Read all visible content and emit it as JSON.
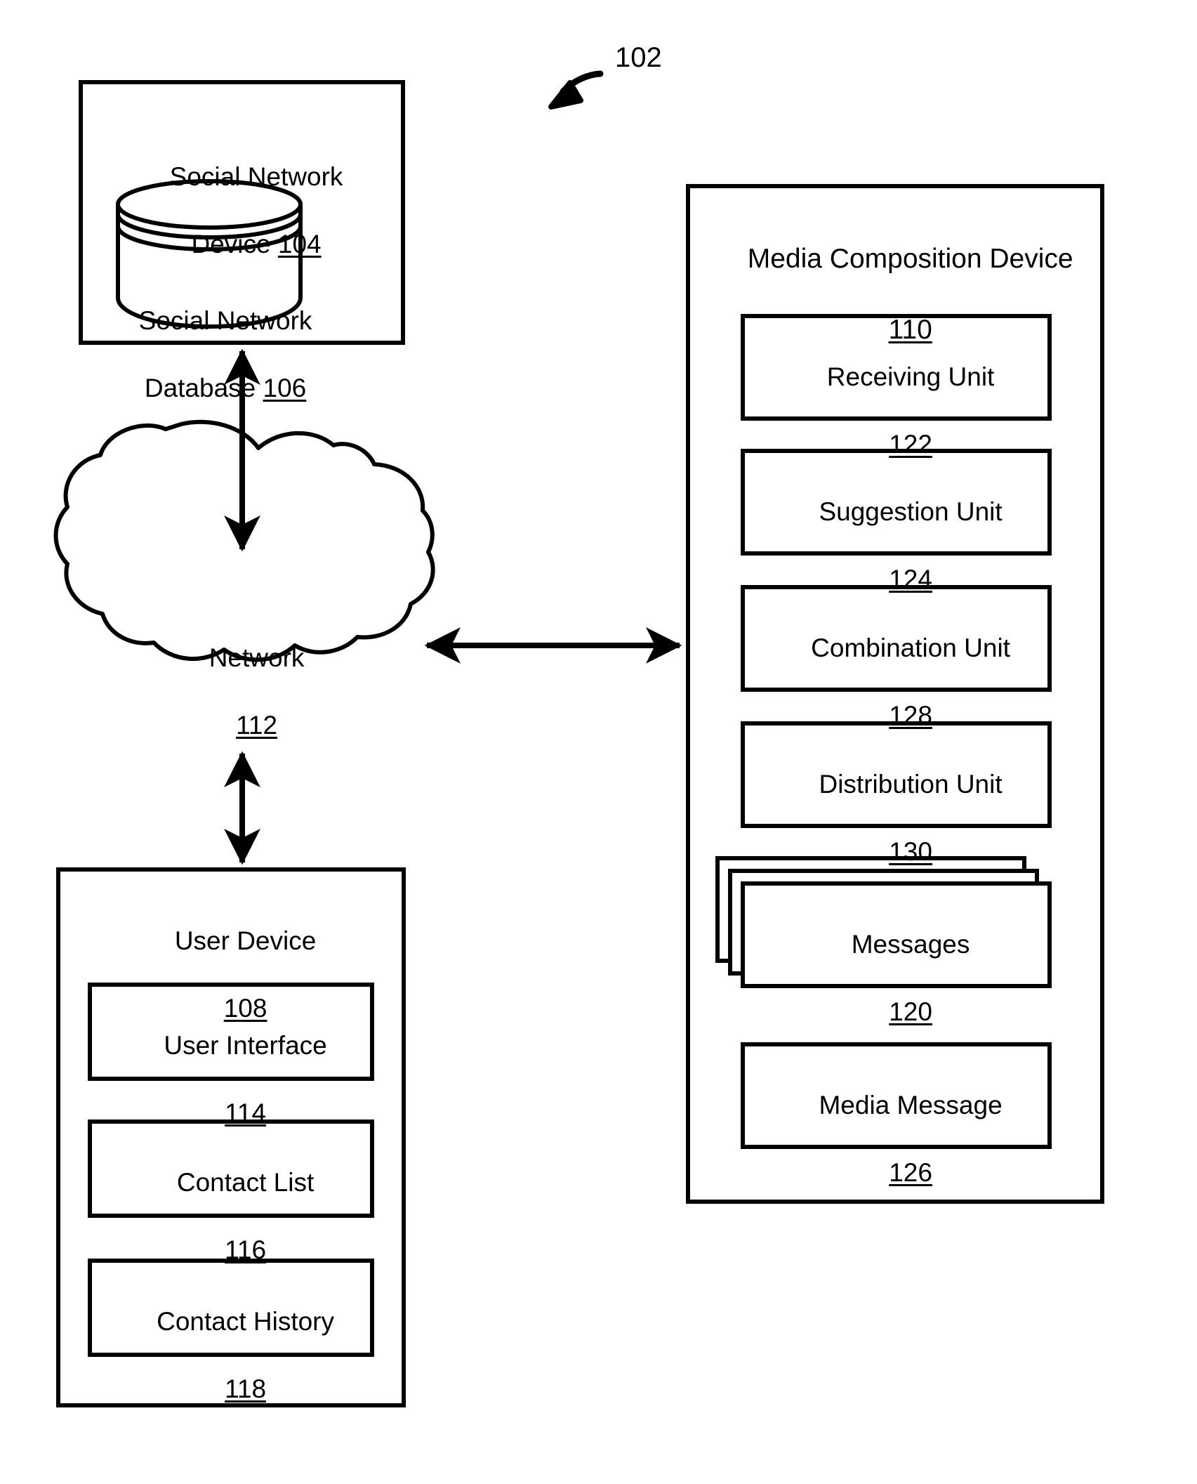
{
  "figure": {
    "reference_numeral": "102",
    "type": "patent-block-diagram",
    "background_color": "#ffffff",
    "line_color": "#000000"
  },
  "nodes": {
    "social_network_device": {
      "title": "Social Network",
      "title_line2": "Device ",
      "numeral": "104",
      "shape": "rectangle"
    },
    "social_network_database": {
      "title": "Social Network",
      "title_line2": "Database ",
      "numeral": "106",
      "shape": "cylinder"
    },
    "network": {
      "title": "Network",
      "numeral": "112",
      "shape": "cloud"
    },
    "user_device": {
      "title": "User Device",
      "numeral": "108",
      "shape": "rectangle",
      "children": [
        {
          "title": "User Interface",
          "numeral": "114",
          "shape": "rectangle"
        },
        {
          "title": "Contact List",
          "numeral": "116",
          "shape": "rectangle"
        },
        {
          "title": "Contact History",
          "numeral": "118",
          "shape": "rectangle"
        }
      ]
    },
    "media_composition_device": {
      "title": "Media Composition Device",
      "numeral": "110",
      "shape": "rectangle",
      "children": [
        {
          "title": "Receiving Unit",
          "numeral": "122",
          "shape": "rectangle"
        },
        {
          "title": "Suggestion Unit",
          "numeral": "124",
          "shape": "rectangle"
        },
        {
          "title": "Combination Unit",
          "numeral": "128",
          "shape": "rectangle"
        },
        {
          "title": "Distribution Unit",
          "numeral": "130",
          "shape": "rectangle"
        },
        {
          "title": "Messages",
          "numeral": "120",
          "shape": "stacked-rectangles"
        },
        {
          "title": "Media Message",
          "numeral": "126",
          "shape": "rectangle"
        }
      ]
    }
  },
  "connectors": [
    {
      "from": "social_network_device",
      "to": "network",
      "style": "double-arrow",
      "orientation": "vertical"
    },
    {
      "from": "network",
      "to": "user_device",
      "style": "double-arrow",
      "orientation": "vertical"
    },
    {
      "from": "network",
      "to": "media_composition_device",
      "style": "double-arrow",
      "orientation": "horizontal"
    },
    {
      "from": "figure-callout",
      "to": "figure",
      "style": "curved-arrow",
      "orientation": "curved"
    }
  ]
}
